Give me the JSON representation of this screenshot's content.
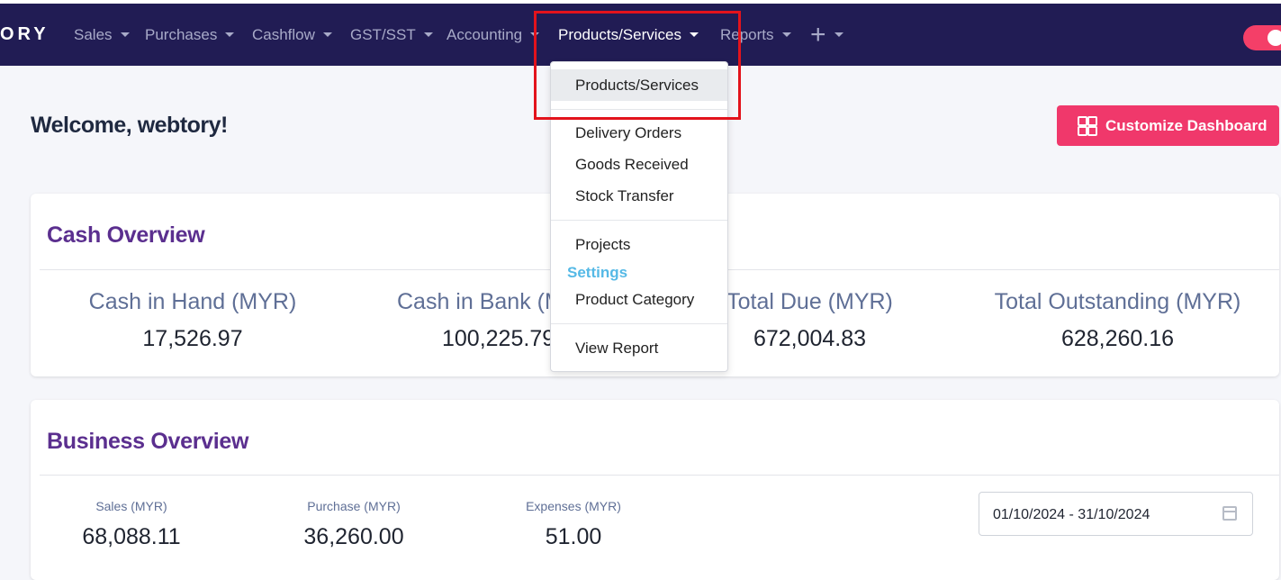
{
  "nav": {
    "brand": "ORY",
    "items": [
      {
        "label": "Sales"
      },
      {
        "label": "Purchases"
      },
      {
        "label": "Cashflow"
      },
      {
        "label": "GST/SST"
      },
      {
        "label": "Accounting"
      },
      {
        "label": "Products/Services"
      },
      {
        "label": "Reports"
      }
    ],
    "plus": "+"
  },
  "dropdown": {
    "items": [
      "Products/Services",
      "Delivery Orders",
      "Goods Received",
      "Stock Transfer",
      "Projects",
      "Product Category",
      "View Report"
    ],
    "settings_header": "Settings"
  },
  "welcome": "Welcome, webtory!",
  "customize_label": "Customize Dashboard",
  "cash_overview": {
    "title": "Cash Overview",
    "metrics": [
      {
        "label": "Cash in Hand (MYR)",
        "value": "17,526.97"
      },
      {
        "label": "Cash in Bank (M",
        "value": "100,225.79"
      },
      {
        "label": "Total Due (MYR)",
        "value": "672,004.83"
      },
      {
        "label": "Total Outstanding (MYR)",
        "value": "628,260.16"
      }
    ]
  },
  "business_overview": {
    "title": "Business Overview",
    "metrics": [
      {
        "label": "Sales (MYR)",
        "value": "68,088.11"
      },
      {
        "label": "Purchase (MYR)",
        "value": "36,260.00"
      },
      {
        "label": "Expenses (MYR)",
        "value": "51.00"
      }
    ],
    "date_range": "01/10/2024 - 31/10/2024"
  },
  "colors": {
    "navbar": "#211c54",
    "accent": "#f0386b",
    "title_purple": "#5b2f8f",
    "settings_blue": "#55b9e6",
    "highlight_red": "#e3131c"
  }
}
